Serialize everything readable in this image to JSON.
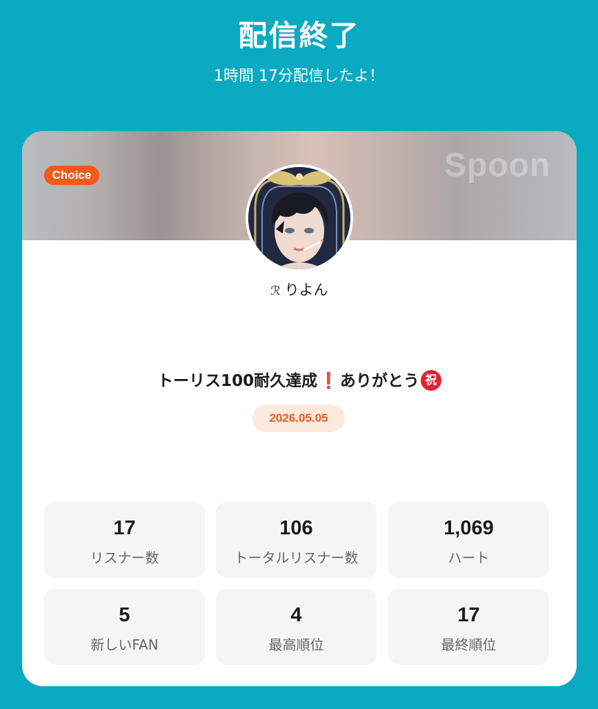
{
  "header": {
    "title": "配信終了",
    "subtitle": "1時間 17分配信したよ！"
  },
  "card": {
    "badge": "Choice",
    "logo": "Spoon",
    "user": {
      "name": "りよん",
      "mark": "ℛ"
    },
    "live_title_main": "トーリス100耐久達成",
    "live_title_bang": "❗",
    "live_title_end": "ありがとう",
    "live_title_emoji": "祝",
    "date": "2026.05.05",
    "colors": {
      "accent": "#f25a1c",
      "background": "#0aaac2"
    }
  },
  "stats": [
    {
      "value": "17",
      "label": "リスナー数"
    },
    {
      "value": "106",
      "label": "トータルリスナー数"
    },
    {
      "value": "1,069",
      "label": "ハート"
    },
    {
      "value": "5",
      "label": "新しいFAN"
    },
    {
      "value": "4",
      "label": "最高順位"
    },
    {
      "value": "17",
      "label": "最終順位"
    }
  ]
}
